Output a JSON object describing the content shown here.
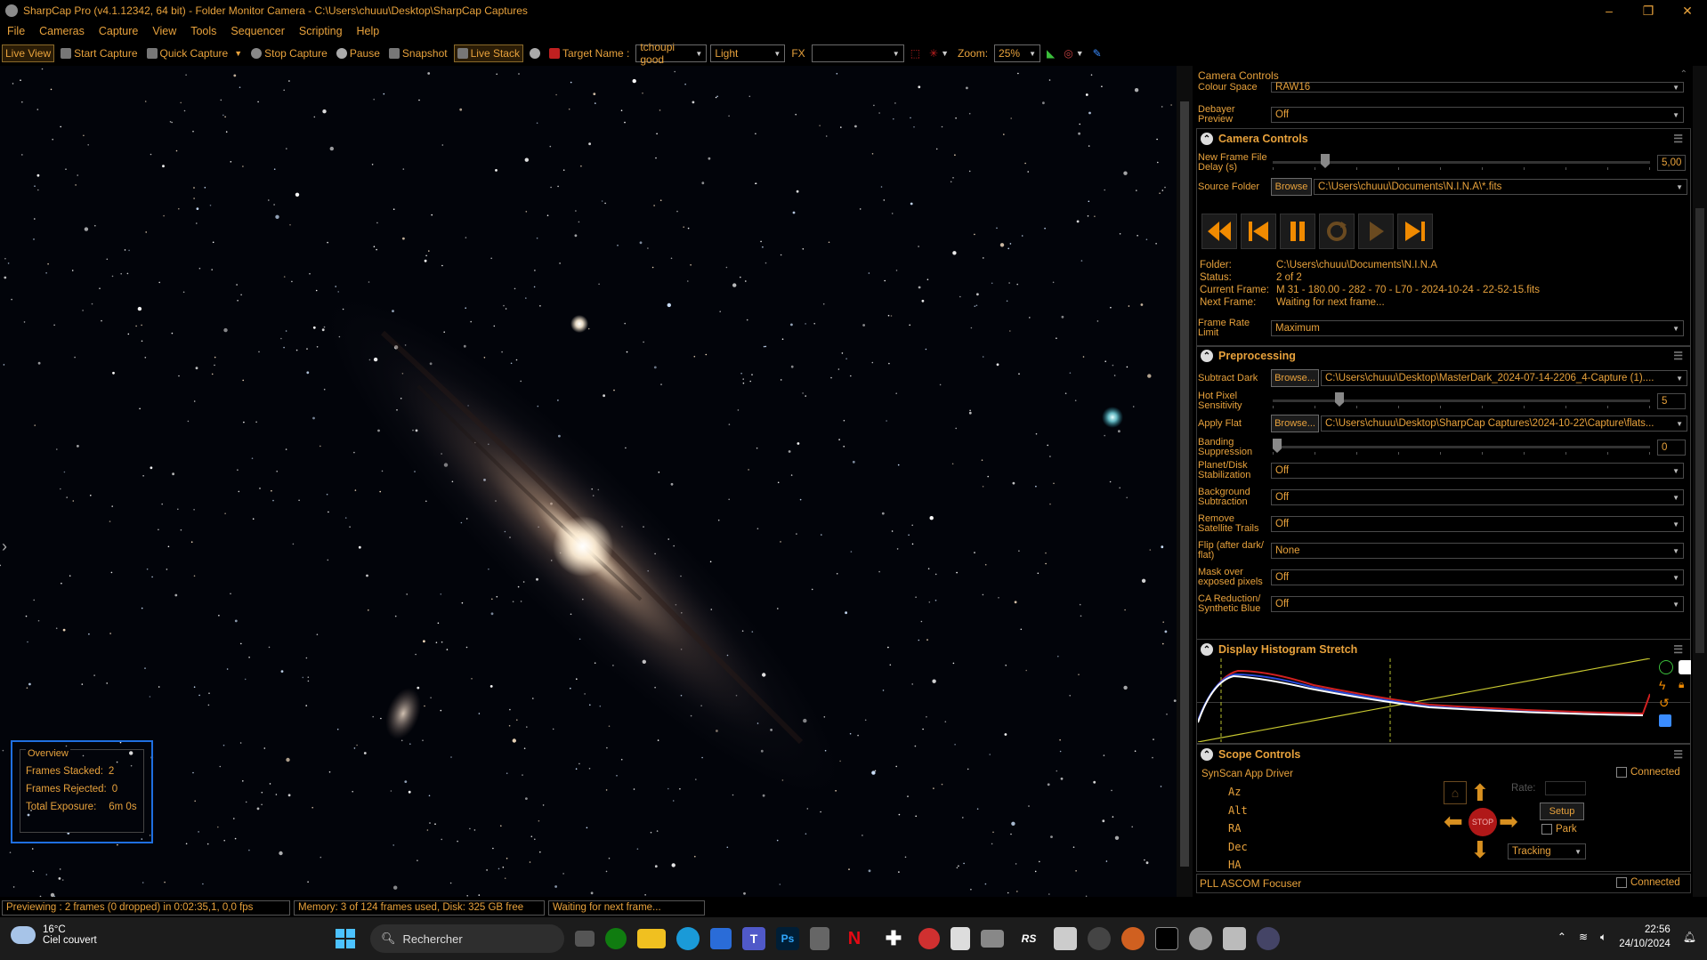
{
  "window": {
    "title": "SharpCap Pro (v4.1.12342, 64 bit) - Folder Monitor Camera - C:\\Users\\chuuu\\Desktop\\SharpCap Captures"
  },
  "menu": [
    "File",
    "Cameras",
    "Capture",
    "View",
    "Tools",
    "Sequencer",
    "Scripting",
    "Help"
  ],
  "toolbar": {
    "live_view": "Live View",
    "start_capture": "Start Capture",
    "quick_capture": "Quick Capture",
    "stop_capture": "Stop Capture",
    "pause": "Pause",
    "snapshot": "Snapshot",
    "live_stack": "Live Stack",
    "target_name_label": "Target Name :",
    "target_name_value": "tchoupi good",
    "frame_type": "Light",
    "fx_label": "FX",
    "fx_value": "",
    "zoom_label": "Zoom:",
    "zoom_value": "25%"
  },
  "overview": {
    "title": "Overview",
    "frames_stacked_label": "Frames Stacked:",
    "frames_stacked": "2",
    "frames_rejected_label": "Frames Rejected:",
    "frames_rejected": "0",
    "total_exposure_label": "Total Exposure:",
    "total_exposure": "6m 0s"
  },
  "panel": {
    "title": "Camera Controls",
    "colour_space_label": "Colour Space",
    "colour_space_value": "RAW16",
    "debayer_label": "Debayer Preview",
    "debayer_value": "Off",
    "camera_controls": {
      "title": "Camera Controls",
      "new_frame_delay_label": "New Frame File Delay (s)",
      "new_frame_delay_value": "5,00",
      "new_frame_delay_level": 0.13,
      "source_folder_label": "Source Folder",
      "browse_label": "Browse",
      "source_folder_value": "C:\\Users\\chuuu\\Documents\\N.I.N.A\\*.fits",
      "folder_label": "Folder:",
      "folder_value": "C:\\Users\\chuuu\\Documents\\N.I.N.A",
      "status_label": "Status:",
      "status_value": "2 of 2",
      "current_frame_label": "Current Frame:",
      "current_frame_value": "M 31 - 180.00 - 282 - 70 - L70 - 2024-10-24 -  22-52-15.fits",
      "next_frame_label": "Next Frame:",
      "next_frame_value": "Waiting for next frame...",
      "frame_rate_label": "Frame Rate Limit",
      "frame_rate_value": "Maximum"
    },
    "preprocessing": {
      "title": "Preprocessing",
      "subtract_dark_label": "Subtract Dark",
      "subtract_dark_browse": "Browse...",
      "subtract_dark_value": "C:\\Users\\chuuu\\Desktop\\MasterDark_2024-07-14-2206_4-Capture (1)....",
      "hot_pixel_label": "Hot Pixel Sensitivity",
      "hot_pixel_value": "5",
      "hot_pixel_level": 0.17,
      "apply_flat_label": "Apply Flat",
      "apply_flat_browse": "Browse...",
      "apply_flat_value": "C:\\Users\\chuuu\\Desktop\\SharpCap Captures\\2024-10-22\\Capture\\flats...",
      "banding_label": "Banding Suppression",
      "banding_value": "0",
      "banding_level": 0.0,
      "planet_label": "Planet/Disk Stabilization",
      "planet_value": "Off",
      "background_label": "Background Subtraction",
      "background_value": "Off",
      "satellite_label": "Remove Satellite Trails",
      "satellite_value": "Off",
      "flip_label": "Flip (after dark/ flat)",
      "flip_value": "None",
      "mask_label": "Mask over exposed pixels",
      "mask_value": "Off",
      "ca_label": "CA Reduction/ Synthetic Blue",
      "ca_value": "Off"
    },
    "histogram": {
      "title": "Display Histogram Stretch"
    },
    "scope": {
      "title": "Scope Controls",
      "driver": "SynScan App Driver",
      "connected_label": "Connected",
      "az": "Az",
      "alt": "Alt",
      "ra": "RA",
      "dec": "Dec",
      "ha": "HA",
      "rate_label": "Rate:",
      "setup_label": "Setup",
      "park_label": "Park",
      "tracking_label": "Tracking",
      "stop_label": "STOP"
    },
    "focuser": {
      "title": "PLL ASCOM Focuser",
      "connected_label": "Connected"
    }
  },
  "status": {
    "preview": "Previewing : 2 frames (0 dropped) in 0:02:35,1, 0,0 fps",
    "memory": "Memory: 3 of 124 frames used, Disk: 325 GB free",
    "waiting": "Waiting for next frame..."
  },
  "taskbar": {
    "temperature": "16°C",
    "weather": "Ciel couvert",
    "search": "Rechercher",
    "time": "22:56",
    "date": "24/10/2024"
  },
  "colors": {
    "accent": "#e8a23c",
    "overview_border": "#1f6fe0"
  }
}
